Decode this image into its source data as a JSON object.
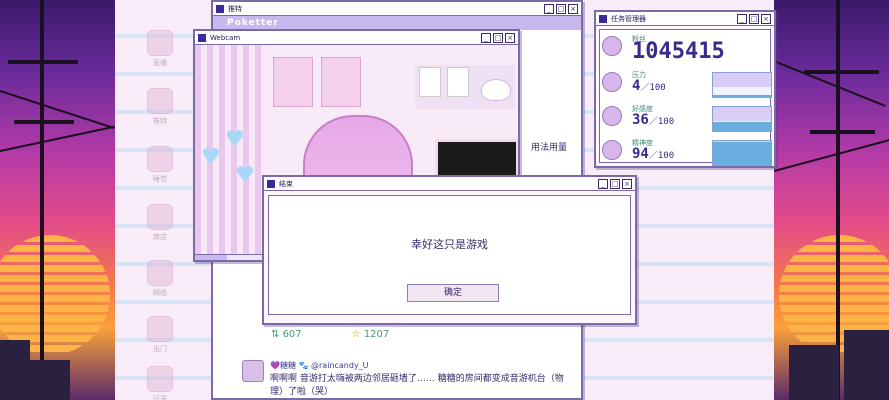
{
  "back_window": {
    "title": "推特",
    "brand": "Poketter",
    "side_text": "用法用量",
    "stats": {
      "retweets": "607",
      "likes": "1207"
    },
    "tweet": {
      "header": "💜糖糖 🐾 @raincandy_U",
      "text": "啊啊啊 音游打太嗨被两边邻居砸墙了…… 糖糖的房间都变成音游机台（物理）了啦（哭）"
    }
  },
  "webcam_window": {
    "title": "Webcam",
    "progress": 0.1
  },
  "dialog": {
    "title": "结束",
    "message": "幸好这只是游戏",
    "ok_label": "确定"
  },
  "task_manager": {
    "title": "任务管理器",
    "rows": [
      {
        "label": "粉丝",
        "value": "1045415",
        "max": "",
        "level": null
      },
      {
        "label": "压力",
        "value": "4",
        "max": "／100",
        "level": 0.04
      },
      {
        "label": "好感度",
        "value": "36",
        "max": "／100",
        "level": 0.36
      },
      {
        "label": "精神度",
        "value": "94",
        "max": "／100",
        "level": 0.94
      }
    ]
  },
  "desktop_icons": [
    "直播",
    "推特",
    "睡觉",
    "商店",
    "网络",
    "出门",
    "记录"
  ],
  "colors": {
    "accent": "#7a6aa6",
    "title_text": "#2a2060",
    "stat_green": "#4a9a7a"
  }
}
